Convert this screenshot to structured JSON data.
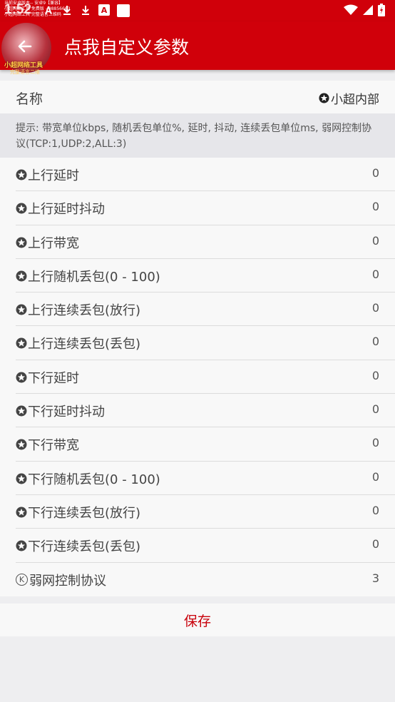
{
  "status_bar": {
    "time": "1:52",
    "overlay_lines": [
      "当前安卓版本-- 安卓9【兼容】",
      "小超网络工具 免费版 - 98856663",
      "小超网络工具 完整语言二维码"
    ],
    "notification_icons": [
      "signal-tower-icon",
      "download-icon",
      "download-icon",
      "app-a-icon",
      "app-square-icon"
    ]
  },
  "app_bar": {
    "title": "点我自定义参数",
    "avatar_caption": "小超网络工具",
    "avatar_subcaption": "完整语言二维"
  },
  "name_row": {
    "label": "名称",
    "value": "小超内部"
  },
  "hint": "提示: 带宽单位kbps, 随机丢包单位%, 延时, 抖动, 连续丢包单位ms, 弱网控制协议(TCP:1,UDP:2,ALL:3)",
  "params": [
    {
      "label": "上行延时",
      "value": "0",
      "icon": "star-icon"
    },
    {
      "label": "上行延时抖动",
      "value": "0",
      "icon": "star-icon"
    },
    {
      "label": "上行带宽",
      "value": "0",
      "icon": "star-icon"
    },
    {
      "label": "上行随机丢包(0 - 100)",
      "value": "0",
      "icon": "star-icon"
    },
    {
      "label": "上行连续丢包(放行)",
      "value": "0",
      "icon": "star-icon"
    },
    {
      "label": "上行连续丢包(丢包)",
      "value": "0",
      "icon": "star-icon"
    },
    {
      "label": "下行延时",
      "value": "0",
      "icon": "star-icon"
    },
    {
      "label": "下行延时抖动",
      "value": "0",
      "icon": "star-icon"
    },
    {
      "label": "下行带宽",
      "value": "0",
      "icon": "star-icon"
    },
    {
      "label": "下行随机丢包(0 - 100)",
      "value": "0",
      "icon": "star-icon"
    },
    {
      "label": "下行连续丢包(放行)",
      "value": "0",
      "icon": "star-icon"
    },
    {
      "label": "下行连续丢包(丢包)",
      "value": "0",
      "icon": "star-icon"
    },
    {
      "label": "弱网控制协议",
      "value": "3",
      "icon": "k-circle-icon",
      "icon_glyph": "K"
    }
  ],
  "save_label": "保存",
  "colors": {
    "accent": "#d0000a",
    "background": "#eeeef0",
    "row_background": "#f8f8f8"
  }
}
